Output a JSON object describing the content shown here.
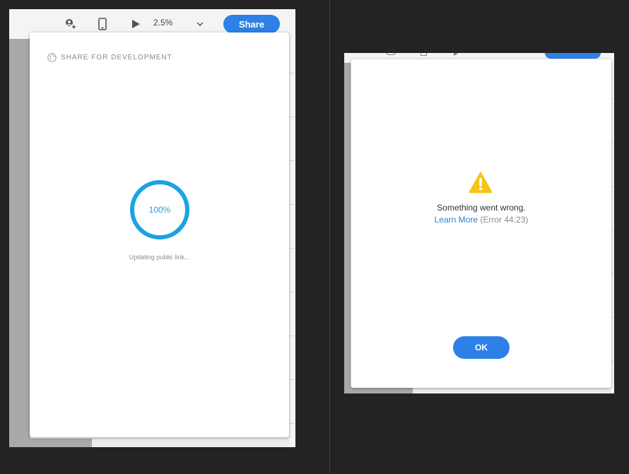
{
  "left_dialog": {
    "toolbar": {
      "zoom_value": "2.5%",
      "share_label": "Share"
    },
    "header_title": "SHARE FOR DEVELOPMENT",
    "progress_percent": 100,
    "progress_label": "100%",
    "status_text": "Updating public link..."
  },
  "right_dialog": {
    "error_message": "Something went wrong.",
    "learn_more_label": "Learn More",
    "error_code": "(Error 44:23)",
    "ok_label": "OK"
  },
  "colors": {
    "accent": "#2d81e6",
    "progress_ring": "#1ca3e0",
    "warning": "#f5c518",
    "link": "#2e7fc4",
    "background": "#232323"
  }
}
